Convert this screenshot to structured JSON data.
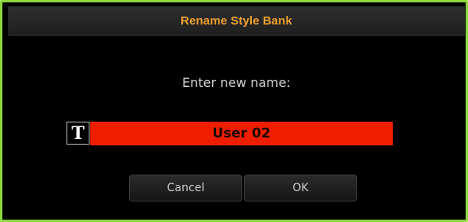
{
  "dialog": {
    "title": "Rename Style Bank",
    "prompt": "Enter new name:",
    "text_icon": {
      "icon": "text-input-icon",
      "glyph": "T"
    },
    "name_field": {
      "value": "User 02"
    },
    "buttons": {
      "cancel_label": "Cancel",
      "ok_label": "OK"
    }
  },
  "colors": {
    "border": "#8dd83f",
    "title": "#f0a030",
    "field_background": "#f01e00",
    "background": "#000000"
  }
}
